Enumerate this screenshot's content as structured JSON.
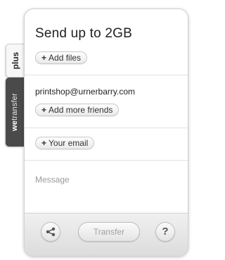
{
  "tabs": {
    "plus_label": "plus",
    "wt_prefix": "we",
    "wt_suffix": "transfer"
  },
  "panel": {
    "title": "Send up to 2GB",
    "add_files_label": "Add files",
    "recipient_email": "printshop@urnerbarry.com",
    "add_friends_label": "Add more friends",
    "your_email_label": "Your email",
    "message_placeholder": "Message"
  },
  "footer": {
    "transfer_label": "Transfer",
    "help_label": "?"
  },
  "icons": {
    "plus": "+",
    "share": "share-icon",
    "help": "help-icon"
  }
}
